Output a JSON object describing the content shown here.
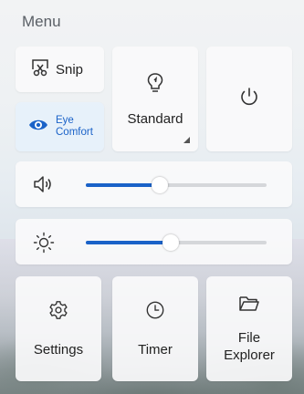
{
  "menu": {
    "title": "Menu"
  },
  "tiles": {
    "snip": {
      "label": "Snip",
      "icon": "snip-icon"
    },
    "eye_comfort": {
      "line1": "Eye",
      "line2": "Comfort",
      "icon": "eye-icon",
      "active": true
    },
    "standard": {
      "label": "Standard",
      "icon": "lightbulb-icon"
    },
    "power": {
      "icon": "power-icon"
    }
  },
  "sliders": {
    "volume": {
      "icon": "speaker-icon",
      "value_fraction": 0.41
    },
    "brightness": {
      "icon": "sun-icon",
      "value_fraction": 0.47
    }
  },
  "bottom": {
    "settings": {
      "label": "Settings",
      "icon": "gear-icon"
    },
    "timer": {
      "label": "Timer",
      "icon": "clock-icon"
    },
    "file_explorer": {
      "line1": "File",
      "line2": "Explorer",
      "icon": "folder-icon"
    }
  },
  "colors": {
    "accent": "#1a62c8",
    "track": "#d5d7da",
    "tile": "#fafafb",
    "active_tile": "#e7f0fa"
  }
}
